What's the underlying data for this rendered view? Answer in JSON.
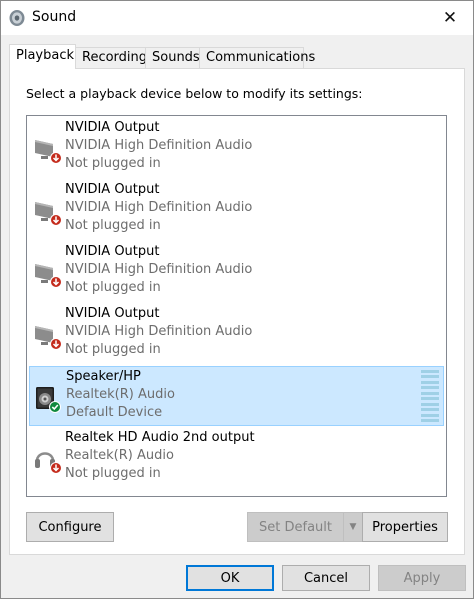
{
  "window": {
    "title": "Sound",
    "close_glyph": "✕"
  },
  "tabs": [
    {
      "label": "Playback",
      "active": true
    },
    {
      "label": "Recording",
      "active": false
    },
    {
      "label": "Sounds",
      "active": false
    },
    {
      "label": "Communications",
      "active": false
    }
  ],
  "instruction": "Select a playback device below to modify its settings:",
  "devices": [
    {
      "name": "NVIDIA Output",
      "driver": "NVIDIA High Definition Audio",
      "status": "Not plugged in",
      "icon": "monitor-speaker-icon",
      "badge": "unplugged"
    },
    {
      "name": "NVIDIA Output",
      "driver": "NVIDIA High Definition Audio",
      "status": "Not plugged in",
      "icon": "monitor-speaker-icon",
      "badge": "unplugged"
    },
    {
      "name": "NVIDIA Output",
      "driver": "NVIDIA High Definition Audio",
      "status": "Not plugged in",
      "icon": "monitor-speaker-icon",
      "badge": "unplugged"
    },
    {
      "name": "NVIDIA Output",
      "driver": "NVIDIA High Definition Audio",
      "status": "Not plugged in",
      "icon": "monitor-speaker-icon",
      "badge": "unplugged"
    },
    {
      "name": "Speaker/HP",
      "driver": "Realtek(R) Audio",
      "status": "Default Device",
      "icon": "speaker-icon",
      "badge": "default",
      "selected": true
    },
    {
      "name": "Realtek HD Audio 2nd output",
      "driver": "Realtek(R) Audio",
      "status": "Not plugged in",
      "icon": "headphones-icon",
      "badge": "unplugged"
    }
  ],
  "panel_buttons": {
    "configure": "Configure",
    "set_default": "Set Default",
    "properties": "Properties"
  },
  "footer_buttons": {
    "ok": "OK",
    "cancel": "Cancel",
    "apply": "Apply"
  },
  "colors": {
    "selection": "#cce8ff",
    "selection_border": "#99d1ff",
    "accent": "#0078d7",
    "unplugged_badge": "#c42b1c",
    "default_badge": "#10893e"
  }
}
